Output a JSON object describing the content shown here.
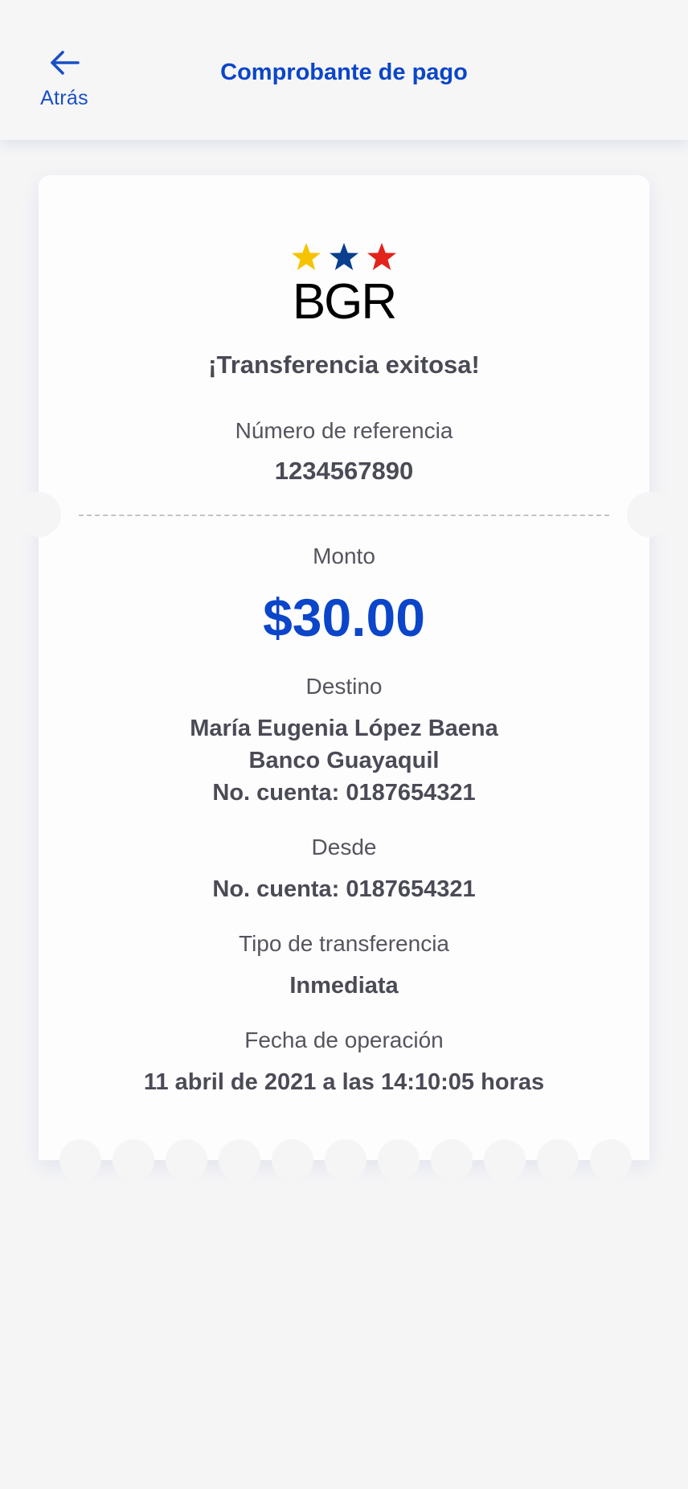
{
  "header": {
    "back_label": "Atrás",
    "title": "Comprobante de pago"
  },
  "receipt": {
    "logo_text": "BGR",
    "logo_star_colors": [
      "#f6c300",
      "#0b3f8e",
      "#e2231a"
    ],
    "success_message": "¡Transferencia exitosa!",
    "reference_label": "Número de referencia",
    "reference_value": "1234567890",
    "amount_label": "Monto",
    "amount_value": "$30.00",
    "destination_label": "Destino",
    "destination_name": "María Eugenia López Baena",
    "destination_bank": "Banco Guayaquil",
    "destination_account": "No. cuenta: 0187654321",
    "from_label": "Desde",
    "from_account": "No. cuenta: 0187654321",
    "transfer_type_label": "Tipo de transferencia",
    "transfer_type_value": "Inmediata",
    "date_label": "Fecha de operación",
    "date_value": "11 abril de 2021 a las 14:10:05 horas"
  },
  "colors": {
    "accent": "#0b45c9",
    "text": "#4b4b57",
    "background": "#f5f5f6"
  }
}
